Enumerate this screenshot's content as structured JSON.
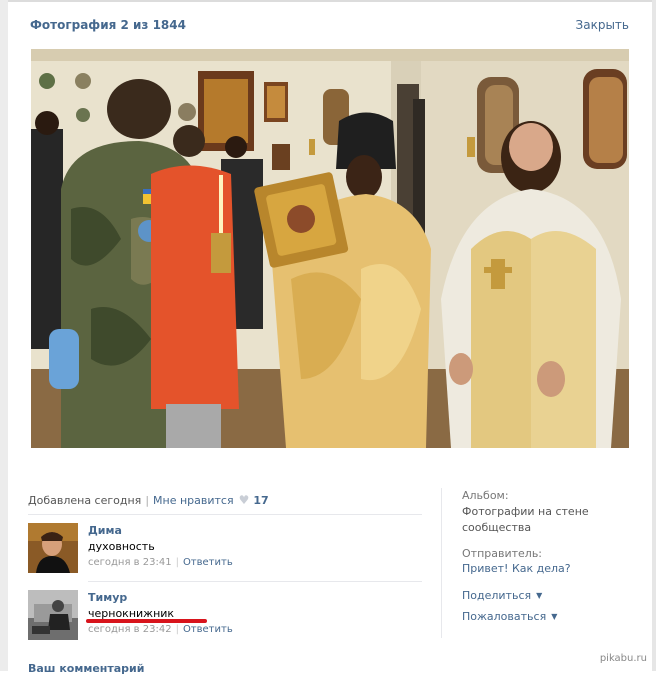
{
  "viewer": {
    "title": "Фотография 2 из 1844",
    "close_label": "Закрыть"
  },
  "photo": {
    "palette": {
      "wall": "#e9e2cd",
      "floor": "#8a6a44",
      "gold": "#e6c070",
      "red": "#e4532b",
      "camo": "#5b6440",
      "white_vest": "#eeeadf"
    }
  },
  "info": {
    "added": "Добавлена сегодня",
    "like_label": "Мне нравится",
    "like_icon": "heart-icon",
    "likes": "17"
  },
  "comments": [
    {
      "author": "Дима",
      "text": "духовность",
      "time": "сегодня в 23:41",
      "reply": "Ответить"
    },
    {
      "author": "Тимур",
      "text": "чернокнижник",
      "time": "сегодня в 23:42",
      "reply": "Ответить"
    }
  ],
  "sidebar": {
    "album_label": "Альбом:",
    "album_value": "Фотографии на стене сообщества",
    "sender_label": "Отправитель:",
    "sender_value": "Привет! Как дела?",
    "share": "Поделиться",
    "report": "Пожаловаться"
  },
  "footer": {
    "your_comment": "Ваш комментарий",
    "watermark": "pikabu.ru"
  },
  "accent": "#45688e",
  "highlight": "#d8141c"
}
